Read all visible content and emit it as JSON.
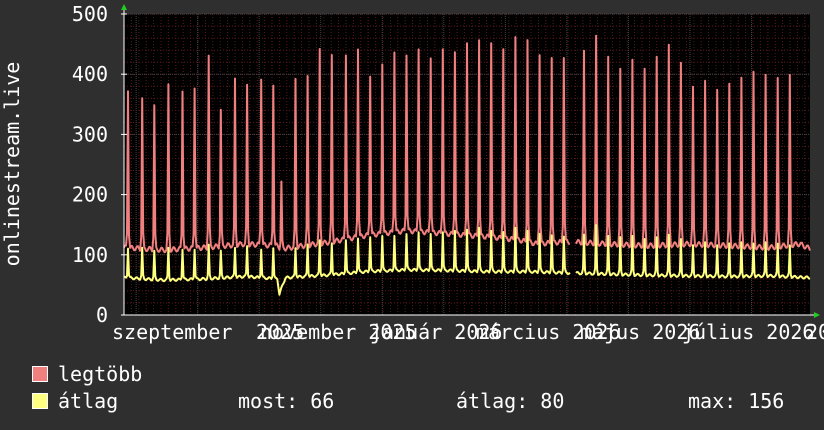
{
  "chart_data": {
    "type": "line",
    "ylabel": "onlinestream.live",
    "ylim": [
      0,
      500
    ],
    "yticks": [
      0,
      100,
      200,
      300,
      400,
      500
    ],
    "grid": true,
    "x_tick_labels": [
      "szeptember",
      "2025",
      "november 2025",
      "január 2026",
      "március 2026",
      "május 2026",
      "július 2026",
      "20"
    ],
    "x_range_days": [
      0,
      340
    ],
    "series": [
      {
        "name": "legtöbb",
        "color": "#f08080",
        "baseline": [
          [
            0,
            112
          ],
          [
            20,
            108
          ],
          [
            40,
            112
          ],
          [
            60,
            118
          ],
          [
            76,
            115
          ],
          [
            78,
            110
          ],
          [
            100,
            120
          ],
          [
            120,
            132
          ],
          [
            140,
            140
          ],
          [
            160,
            135
          ],
          [
            180,
            130
          ],
          [
            195,
            125
          ],
          [
            205,
            118
          ],
          [
            220,
            122
          ],
          [
            240,
            118
          ],
          [
            260,
            115
          ],
          [
            280,
            118
          ],
          [
            300,
            115
          ],
          [
            320,
            112
          ],
          [
            335,
            118
          ],
          [
            340,
            110
          ]
        ],
        "peaks": [
          [
            2,
            375
          ],
          [
            9,
            360
          ],
          [
            15,
            348
          ],
          [
            22,
            380
          ],
          [
            29,
            375
          ],
          [
            35,
            380
          ],
          [
            42,
            430
          ],
          [
            48,
            340
          ],
          [
            55,
            390
          ],
          [
            61,
            380
          ],
          [
            68,
            395
          ],
          [
            74,
            385
          ],
          [
            78,
            220
          ],
          [
            85,
            390
          ],
          [
            91,
            395
          ],
          [
            97,
            440
          ],
          [
            103,
            430
          ],
          [
            110,
            435
          ],
          [
            116,
            445
          ],
          [
            122,
            400
          ],
          [
            128,
            420
          ],
          [
            134,
            440
          ],
          [
            140,
            435
          ],
          [
            146,
            445
          ],
          [
            152,
            430
          ],
          [
            158,
            445
          ],
          [
            164,
            440
          ],
          [
            170,
            455
          ],
          [
            176,
            460
          ],
          [
            182,
            455
          ],
          [
            188,
            445
          ],
          [
            194,
            465
          ],
          [
            200,
            460
          ],
          [
            206,
            435
          ],
          [
            212,
            430
          ],
          [
            218,
            430
          ],
          [
            228,
            435
          ],
          [
            234,
            460
          ],
          [
            240,
            425
          ],
          [
            246,
            405
          ],
          [
            252,
            420
          ],
          [
            258,
            405
          ],
          [
            264,
            425
          ],
          [
            270,
            445
          ],
          [
            276,
            415
          ],
          [
            282,
            375
          ],
          [
            288,
            385
          ],
          [
            294,
            370
          ],
          [
            300,
            380
          ],
          [
            306,
            390
          ],
          [
            312,
            400
          ],
          [
            318,
            395
          ],
          [
            324,
            390
          ],
          [
            330,
            395
          ]
        ],
        "gaps": [
          [
            221,
            224
          ]
        ]
      },
      {
        "name": "átlag",
        "color": "#ffff80",
        "baseline": [
          [
            0,
            62
          ],
          [
            20,
            58
          ],
          [
            40,
            60
          ],
          [
            60,
            64
          ],
          [
            76,
            60
          ],
          [
            77,
            35
          ],
          [
            80,
            62
          ],
          [
            100,
            66
          ],
          [
            120,
            72
          ],
          [
            140,
            75
          ],
          [
            160,
            74
          ],
          [
            180,
            72
          ],
          [
            200,
            72
          ],
          [
            220,
            70
          ],
          [
            240,
            68
          ],
          [
            260,
            66
          ],
          [
            280,
            65
          ],
          [
            300,
            64
          ],
          [
            320,
            65
          ],
          [
            340,
            62
          ]
        ],
        "peaks": [
          [
            2,
            112
          ],
          [
            9,
            110
          ],
          [
            15,
            105
          ],
          [
            22,
            112
          ],
          [
            29,
            110
          ],
          [
            35,
            110
          ],
          [
            42,
            115
          ],
          [
            48,
            105
          ],
          [
            55,
            112
          ],
          [
            61,
            115
          ],
          [
            68,
            110
          ],
          [
            74,
            112
          ],
          [
            85,
            112
          ],
          [
            91,
            118
          ],
          [
            97,
            125
          ],
          [
            103,
            120
          ],
          [
            110,
            125
          ],
          [
            116,
            128
          ],
          [
            122,
            130
          ],
          [
            128,
            132
          ],
          [
            134,
            132
          ],
          [
            140,
            135
          ],
          [
            146,
            138
          ],
          [
            152,
            135
          ],
          [
            158,
            138
          ],
          [
            164,
            140
          ],
          [
            170,
            142
          ],
          [
            176,
            145
          ],
          [
            182,
            140
          ],
          [
            188,
            138
          ],
          [
            194,
            145
          ],
          [
            200,
            140
          ],
          [
            206,
            135
          ],
          [
            212,
            132
          ],
          [
            218,
            130
          ],
          [
            228,
            132
          ],
          [
            234,
            148
          ],
          [
            240,
            130
          ],
          [
            246,
            128
          ],
          [
            252,
            130
          ],
          [
            258,
            125
          ],
          [
            264,
            128
          ],
          [
            270,
            132
          ],
          [
            276,
            125
          ],
          [
            282,
            115
          ],
          [
            288,
            120
          ],
          [
            294,
            115
          ],
          [
            300,
            118
          ],
          [
            306,
            120
          ],
          [
            312,
            118
          ],
          [
            318,
            120
          ],
          [
            324,
            118
          ],
          [
            330,
            115
          ]
        ],
        "gaps": [
          [
            221,
            224
          ]
        ]
      }
    ]
  },
  "legend": {
    "items": [
      {
        "label": "legtöbb",
        "color": "#f08080"
      },
      {
        "label": "átlag",
        "color": "#ffff80"
      }
    ],
    "stats": {
      "now_label": "most: 66",
      "avg_label": "átlag: 80",
      "max_label": "max: 156"
    }
  },
  "colors": {
    "background": "#2f2f2f",
    "plot_background": "#000000",
    "grid_minor": "#5a1a1a",
    "grid_major": "#444444",
    "axis": "#ffffff",
    "arrow": "#22cc22"
  }
}
